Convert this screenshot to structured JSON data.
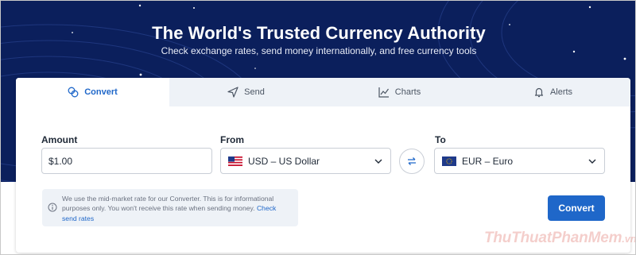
{
  "hero": {
    "title": "The World's Trusted Currency Authority",
    "subtitle": "Check exchange rates, send money internationally, and free currency tools"
  },
  "tabs": [
    {
      "label": "Convert",
      "icon": "convert-icon",
      "active": true
    },
    {
      "label": "Send",
      "icon": "send-icon",
      "active": false
    },
    {
      "label": "Charts",
      "icon": "chart-icon",
      "active": false
    },
    {
      "label": "Alerts",
      "icon": "bell-icon",
      "active": false
    }
  ],
  "form": {
    "amount_label": "Amount",
    "amount_value": "$1.00",
    "from_label": "From",
    "from_value": "USD – US Dollar",
    "from_flag": "us-flag-icon",
    "to_label": "To",
    "to_value": "EUR – Euro",
    "to_flag": "eu-flag-icon"
  },
  "info": {
    "text": "We use the mid-market rate for our Converter. This is for informational purposes only. You won't receive this rate when sending money.",
    "link": "Check send rates"
  },
  "convert_button": "Convert",
  "watermark": {
    "main": "ThuThuatPhanMem",
    "suffix": ".vn"
  },
  "colors": {
    "hero_bg": "#0b1f5c",
    "accent": "#1f67c9",
    "tab_bg": "#eef2f7"
  }
}
